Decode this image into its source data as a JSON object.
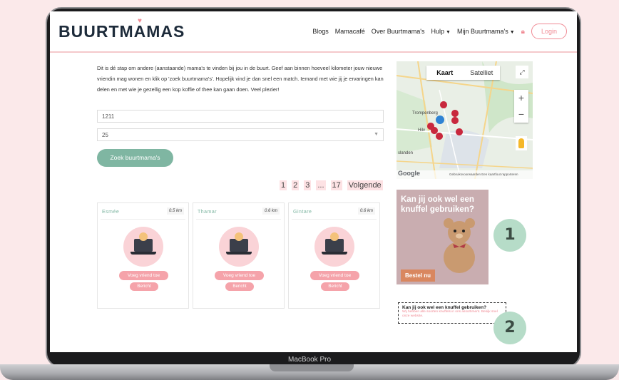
{
  "device": {
    "label": "MacBook Pro"
  },
  "header": {
    "logo": "BUURTMAMAS",
    "nav": [
      {
        "label": "Blogs",
        "has_dropdown": false
      },
      {
        "label": "Mamacafé",
        "has_dropdown": false
      },
      {
        "label": "Over Buurtmama's",
        "has_dropdown": false
      },
      {
        "label": "Hulp",
        "has_dropdown": true
      },
      {
        "label": "Mijn Buurtmama's",
        "has_dropdown": true
      }
    ],
    "login_label": "Login"
  },
  "main": {
    "intro": "Dit is dé stap om andere (aanstaande) mama's te vinden bij jou in de buurt. Geef aan binnen hoeveel kilometer jouw nieuwe vriendin mag wonen en klik op 'zoek buurtmama's'. Hopelijk vind je dan snel een match. Iemand met wie jij je ervaringen kan delen en met wie je gezellig een kop koffie of thee kan gaan doen. Veel plezier!",
    "postcode_value": "1211",
    "distance_value": "25",
    "search_button": "Zoek buurtmama's",
    "pagination": [
      "1",
      "2",
      "3",
      "...",
      "17",
      "Volgende"
    ],
    "cards": [
      {
        "name": "Esmée",
        "distance": "0.5 km",
        "friend_label": "Voeg vriend toe",
        "message_label": "Bericht"
      },
      {
        "name": "Thamar",
        "distance": "0.6 km",
        "friend_label": "Voeg vriend toe",
        "message_label": "Bericht"
      },
      {
        "name": "Gintare",
        "distance": "0.6 km",
        "friend_label": "Voeg vriend toe",
        "message_label": "Bericht"
      }
    ]
  },
  "map": {
    "tabs": [
      "Kaart",
      "Satelliet"
    ],
    "active_tab": "Kaart",
    "places": [
      "Trompenberg",
      "Hilv",
      "slanden"
    ],
    "footer": "Gebruiksvoorwaarden  Een kaartfout rapporteren",
    "brand": "Google"
  },
  "ads": {
    "ad1": {
      "title": "Kan jij ook wel een knuffel gebruiken?",
      "button": "Bestel nu"
    },
    "ad2": {
      "title": "Kan jij ook wel een knuffel gebruiken?",
      "subtitle": "Wij hebben alle soorten knuffels in ons assortiment. Bekijk snel onze website."
    },
    "badges": [
      "1",
      "2"
    ]
  },
  "colors": {
    "accent_pink": "#f08b95",
    "accent_green": "#7fb6a2",
    "background": "#fbe9ea"
  }
}
